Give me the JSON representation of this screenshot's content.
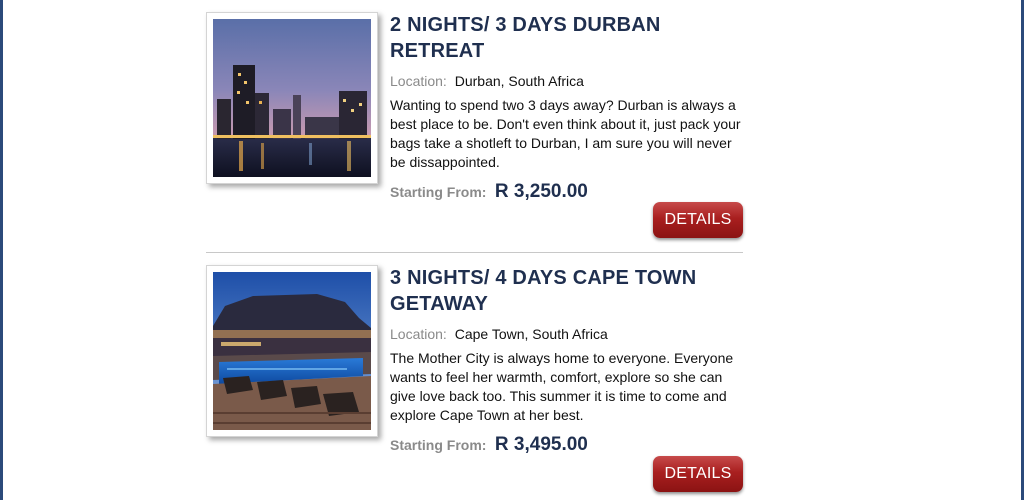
{
  "listings": [
    {
      "title": "2 NIGHTS/ 3 DAYS DURBAN RETREAT",
      "location_label": "Location:",
      "location": "Durban, South Africa",
      "description": "Wanting to spend two 3 days away? Durban is always a best place to be. Don't even think about it, just pack your bags take a shotleft to Durban, I am sure you will never be dissappointed.",
      "price_label": "Starting From:",
      "price": "R 3,250.00",
      "button_label": "DETAILS"
    },
    {
      "title": "3 NIGHTS/ 4 DAYS CAPE TOWN GETAWAY",
      "location_label": "Location:",
      "location": "Cape Town, South Africa",
      "description": "The Mother City is always home to everyone. Everyone wants to feel her warmth, comfort, explore so she can give love back too. This summer it is time to come and explore Cape Town at her best.",
      "price_label": "Starting From:",
      "price": "R 3,495.00",
      "button_label": "DETAILS"
    }
  ],
  "colors": {
    "title": "#1f2f4f",
    "button": "#a91f1f",
    "frame": "#2b4a7a"
  }
}
